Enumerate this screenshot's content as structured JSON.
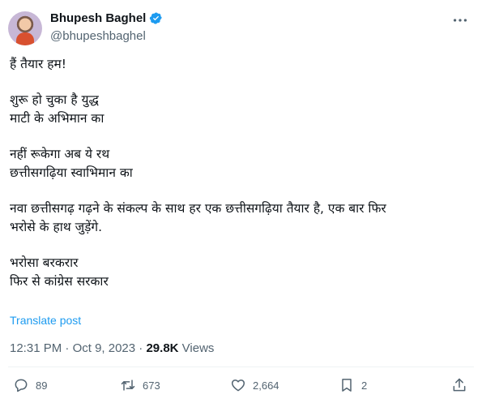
{
  "author": {
    "display_name": "Bhupesh Baghel",
    "handle": "@bhupeshbaghel",
    "verified": true
  },
  "tweet": {
    "lines": [
      "हैं तैयार हम!",
      "",
      "शुरू हो चुका है युद्ध",
      "माटी के अभिमान का",
      "",
      "नहीं रूकेगा अब ये रथ",
      "छत्तीसगढ़िया स्वाभिमान का",
      "",
      "नवा छत्तीसगढ़ गढ़ने के संकल्प के साथ हर एक छत्तीसगढ़िया तैयार है, एक बार फिर",
      "भरोसे के हाथ जुड़ेंगे.",
      "",
      "भरोसा बरकरार",
      "फिर से कांग्रेस सरकार"
    ],
    "translate_label": "Translate post"
  },
  "meta": {
    "time": "12:31 PM",
    "separator": "·",
    "date": "Oct 9, 2023",
    "views_count": "29.8K",
    "views_label": "Views"
  },
  "actions": {
    "replies": "89",
    "reposts": "673",
    "likes": "2,664",
    "bookmarks": "2"
  },
  "icons": {
    "verified": "verified-badge-icon",
    "more": "more-options-icon",
    "reply": "reply-icon",
    "repost": "repost-icon",
    "like": "heart-icon",
    "bookmark": "bookmark-icon",
    "share": "share-icon"
  },
  "colors": {
    "accent": "#1d9bf0",
    "secondary_text": "#536471",
    "primary_text": "#0f1419"
  }
}
